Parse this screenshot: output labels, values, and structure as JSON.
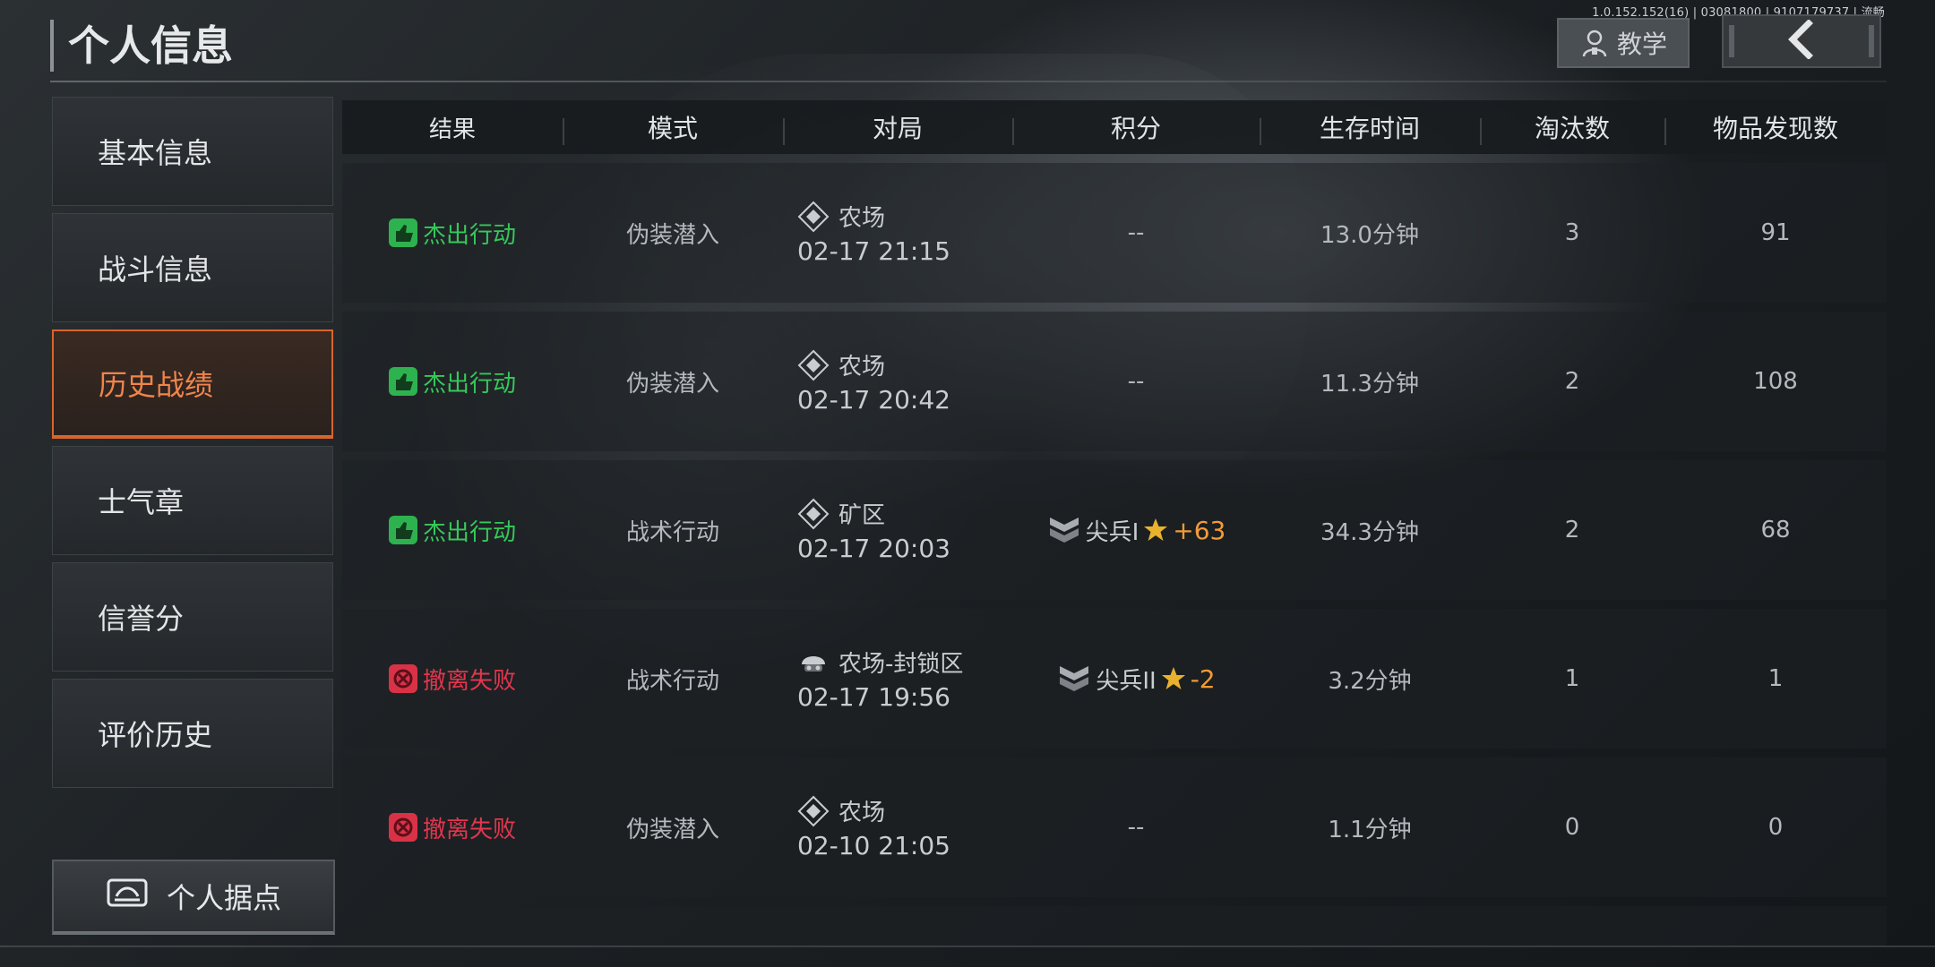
{
  "version_text": "1.0.152.152(16) | 03081800 | 9107179737 | 流畅",
  "page_title": "个人信息",
  "header": {
    "tutorial_label": "教学"
  },
  "sidebar": {
    "items": [
      {
        "label": "基本信息",
        "active": false
      },
      {
        "label": "战斗信息",
        "active": false
      },
      {
        "label": "历史战绩",
        "active": true
      },
      {
        "label": "士气章",
        "active": false
      },
      {
        "label": "信誉分",
        "active": false
      },
      {
        "label": "评价历史",
        "active": false
      }
    ],
    "base_button_label": "个人据点"
  },
  "table": {
    "headers": [
      "结果",
      "模式",
      "对局",
      "积分",
      "生存时间",
      "淘汰数",
      "物品发现数"
    ],
    "rows": [
      {
        "result": "杰出行动",
        "result_type": "success",
        "mode": "伪装潜入",
        "map": "农场",
        "map_icon": "diamond-map-icon",
        "datetime": "02-17 21:15",
        "score": "--",
        "rank": "",
        "delta": "",
        "survival": "13.0分钟",
        "kills": "3",
        "items": "91"
      },
      {
        "result": "杰出行动",
        "result_type": "success",
        "mode": "伪装潜入",
        "map": "农场",
        "map_icon": "diamond-map-icon",
        "datetime": "02-17 20:42",
        "score": "--",
        "rank": "",
        "delta": "",
        "survival": "11.3分钟",
        "kills": "2",
        "items": "108"
      },
      {
        "result": "杰出行动",
        "result_type": "success",
        "mode": "战术行动",
        "map": "矿区",
        "map_icon": "diamond-map-icon",
        "datetime": "02-17 20:03",
        "score": "",
        "rank": "尖兵I",
        "delta": "+63",
        "survival": "34.3分钟",
        "kills": "2",
        "items": "68"
      },
      {
        "result": "撤离失败",
        "result_type": "fail",
        "mode": "战术行动",
        "map": "农场-封锁区",
        "map_icon": "helmet-map-icon",
        "datetime": "02-17 19:56",
        "score": "",
        "rank": "尖兵II",
        "delta": "-2",
        "survival": "3.2分钟",
        "kills": "1",
        "items": "1"
      },
      {
        "result": "撤离失败",
        "result_type": "fail",
        "mode": "伪装潜入",
        "map": "农场",
        "map_icon": "diamond-map-icon",
        "datetime": "02-10 21:05",
        "score": "--",
        "rank": "",
        "delta": "",
        "survival": "1.1分钟",
        "kills": "0",
        "items": "0"
      }
    ]
  },
  "colors": {
    "accent": "#d8652c",
    "success": "#35c95a",
    "fail": "#e2364d",
    "delta": "#f39b34"
  },
  "icons": {
    "tutorial": "person-icon",
    "back": "chevron-left-icon",
    "base": "base-icon",
    "success": "thumbs-up-icon",
    "fail": "fail-badge-icon",
    "rank": "chevron-rank-icon",
    "star": "star-icon"
  }
}
